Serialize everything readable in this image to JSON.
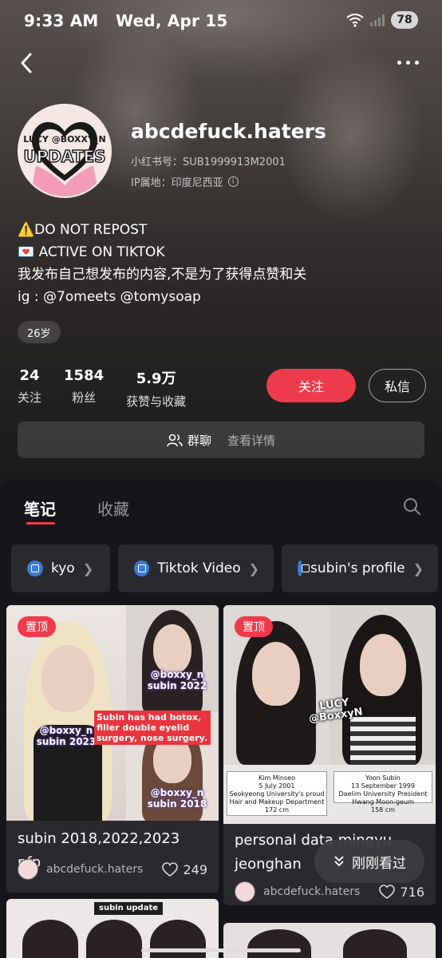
{
  "status": {
    "time": "9:33 AM",
    "date": "Wed, Apr 15",
    "battery": "78"
  },
  "profile": {
    "avatar_line1": "LUCY @BOXXY_N",
    "avatar_line2": "UPDATES",
    "username": "abcdefuck.haters",
    "red_id": "小红书号：SUB1999913M2001",
    "ip_location": "IP属地：印度尼西亚",
    "bio": [
      "⚠️DO NOT REPOST",
      "💌 ACTIVE ON TIKTOK",
      "我发布自己想发布的内容,不是为了获得点赞和关",
      "ig : @7omeets @tomysoap"
    ],
    "age_tag": "26岁"
  },
  "stats": [
    {
      "value": "24",
      "label": "关注"
    },
    {
      "value": "1584",
      "label": "粉丝"
    },
    {
      "value": "5.9万",
      "label": "获赞与收藏"
    }
  ],
  "actions": {
    "follow": "关注",
    "message": "私信"
  },
  "group_chat": {
    "label": "群聊",
    "detail": "查看详情"
  },
  "tabs": {
    "notes": "笔记",
    "collections": "收藏"
  },
  "collections": [
    "kyo",
    "Tiktok Video",
    "subin's profile"
  ],
  "notes": [
    {
      "pinned": "置顶",
      "title": "subin 2018,2022,2023 pfp",
      "author": "abcdefuck.haters",
      "likes": "249",
      "image_text": {
        "cap1": "@boxxy_n subin 2022",
        "cap2": "@boxxy_n subin 2023",
        "red": "Subin has had botox, filler double eyelid surgery, nose surgery.",
        "cap3": "@boxxy_n subin 2018"
      }
    },
    {
      "pinned": "置顶",
      "title": "personal data mingyu jeonghan",
      "author": "abcdefuck.haters",
      "likes": "716",
      "image_text": {
        "stamp": "LUCY @BoxxyN",
        "id1": "Kim Minseo\n5 July 2001\nSeokyeong University's proud Hair and Makeup Department\n172 cm",
        "id2": "Yoon Subin\n13 September 1999\nDaelim University President Hwang Moon-geum\n158 cm"
      }
    }
  ],
  "more_card_label": "subin update",
  "recent_pill": "刚刚看过",
  "colors": {
    "accent": "#ee3b4b",
    "panel": "#16161a",
    "card": "#2a2a2e",
    "link_icon": "#3a7bd5"
  }
}
